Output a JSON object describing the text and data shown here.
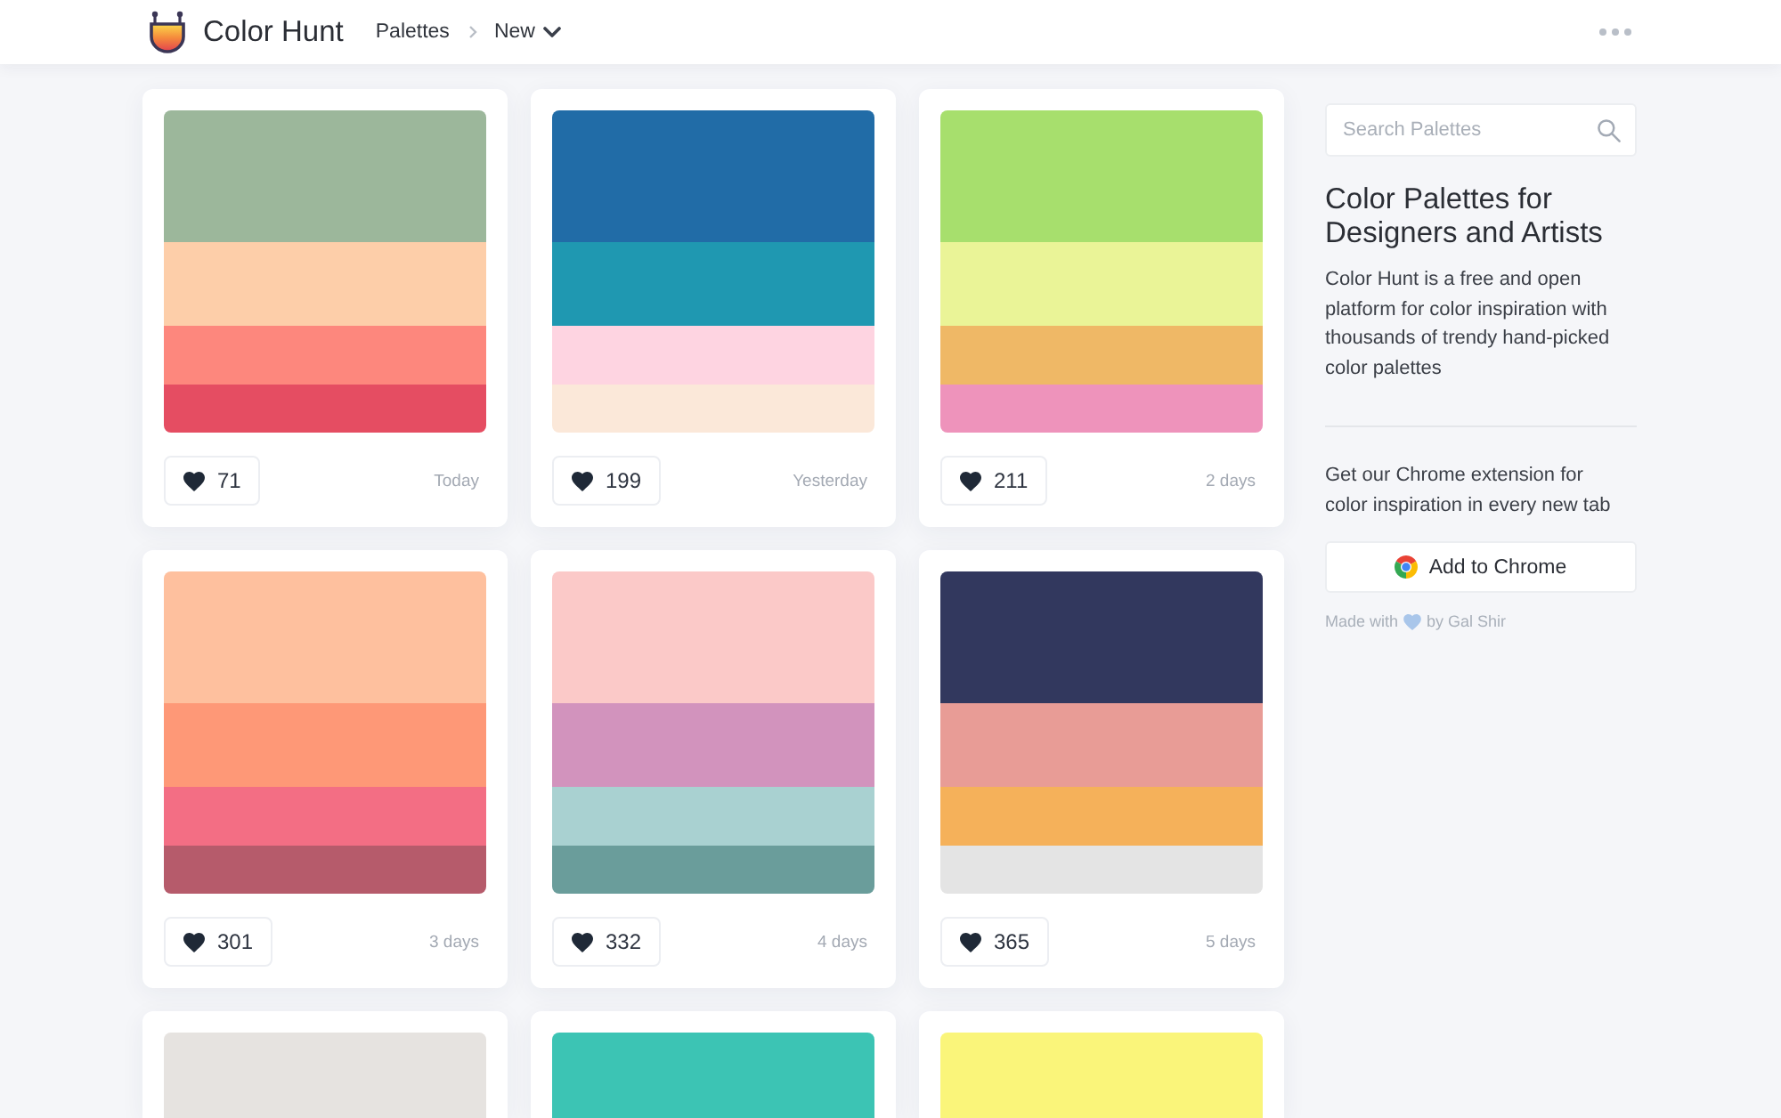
{
  "header": {
    "site_title": "Color Hunt",
    "breadcrumb": "Palettes",
    "sort_dropdown": "New"
  },
  "palettes": [
    {
      "colors": [
        {
          "color": "#9cb79b"
        },
        {
          "color": "#fdcea9"
        },
        {
          "color": "#fd877d"
        },
        {
          "color": "#e54d62"
        }
      ],
      "likes": "71",
      "age": "Today"
    },
    {
      "colors": [
        {
          "color": "#216ca7"
        },
        {
          "color": "#1f98b1"
        },
        {
          "color": "#fed4e1"
        },
        {
          "color": "#fbe8d9"
        }
      ],
      "likes": "199",
      "age": "Yesterday"
    },
    {
      "colors": [
        {
          "color": "#a7df6d"
        },
        {
          "color": "#eaf497"
        },
        {
          "color": "#efb866"
        },
        {
          "color": "#ee93bb"
        }
      ],
      "likes": "211",
      "age": "2 days"
    },
    {
      "colors": [
        {
          "color": "#fec09e"
        },
        {
          "color": "#fe9877"
        },
        {
          "color": "#f36e84"
        },
        {
          "color": "#b65b6b"
        }
      ],
      "likes": "301",
      "age": "3 days"
    },
    {
      "colors": [
        {
          "color": "#fbc9c8"
        },
        {
          "color": "#d293bd"
        },
        {
          "color": "#a9d1d1"
        },
        {
          "color": "#6a9d9b"
        }
      ],
      "likes": "332",
      "age": "4 days"
    },
    {
      "colors": [
        {
          "color": "#32385e"
        },
        {
          "color": "#e89c96"
        },
        {
          "color": "#f5b15a"
        },
        {
          "color": "#e4e4e4"
        }
      ],
      "likes": "365",
      "age": "5 days"
    },
    {
      "colors": [
        {
          "color": "#e6e3e0"
        }
      ]
    },
    {
      "colors": [
        {
          "color": "#3cc4b4"
        }
      ]
    },
    {
      "colors": [
        {
          "color": "#faf57a"
        }
      ]
    }
  ],
  "sidebar": {
    "search": {
      "placeholder": "Search Palettes"
    },
    "heading": "Color Palettes for Designers and Artists",
    "description": "Color Hunt is a free and open platform for color inspiration with thousands of trendy hand-picked color palettes",
    "extension_text": "Get our Chrome extension for color inspiration in every new tab",
    "extension_button": "Add to Chrome",
    "credit": {
      "before_icon": "Made with",
      "after_icon": "by Gal Shir"
    }
  }
}
